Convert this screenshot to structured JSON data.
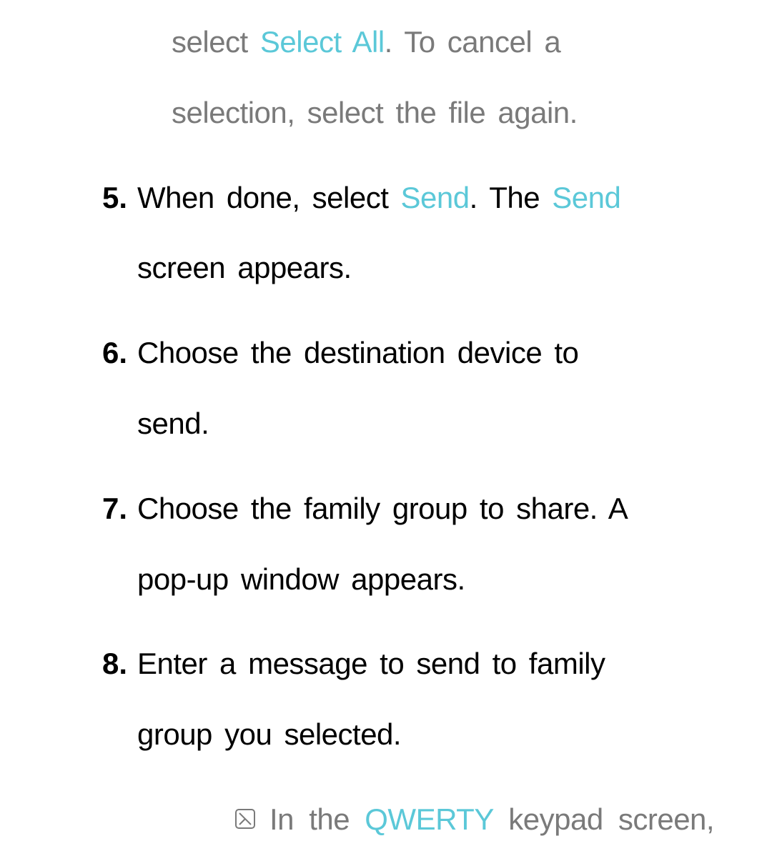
{
  "intro": {
    "line1_pre": "select ",
    "line1_select_all": "Select All",
    "line1_post": ". To cancel a",
    "line2": "selection, select the file again."
  },
  "steps": [
    {
      "num": "5.",
      "parts": [
        {
          "pre": "When done, select ",
          "hl1": "Send",
          "mid": ". The ",
          "hl2": "Send",
          "post": ""
        },
        {
          "pre": "screen appears.",
          "hl1": "",
          "mid": "",
          "hl2": "",
          "post": ""
        }
      ]
    },
    {
      "num": "6.",
      "parts": [
        {
          "pre": "Choose the destination device to",
          "hl1": "",
          "mid": "",
          "hl2": "",
          "post": ""
        },
        {
          "pre": "send.",
          "hl1": "",
          "mid": "",
          "hl2": "",
          "post": ""
        }
      ]
    },
    {
      "num": "7.",
      "parts": [
        {
          "pre": "Choose the family group to share. A",
          "hl1": "",
          "mid": "",
          "hl2": "",
          "post": ""
        },
        {
          "pre": "pop-up window appears.",
          "hl1": "",
          "mid": "",
          "hl2": "",
          "post": ""
        }
      ]
    },
    {
      "num": "8.",
      "parts": [
        {
          "pre": "Enter a message to send to family",
          "hl1": "",
          "mid": "",
          "hl2": "",
          "post": ""
        },
        {
          "pre": "group you selected.",
          "hl1": "",
          "mid": "",
          "hl2": "",
          "post": ""
        }
      ]
    }
  ],
  "note": {
    "pre": "In the ",
    "hl": "QWERTY",
    "post": " keypad screen,"
  }
}
